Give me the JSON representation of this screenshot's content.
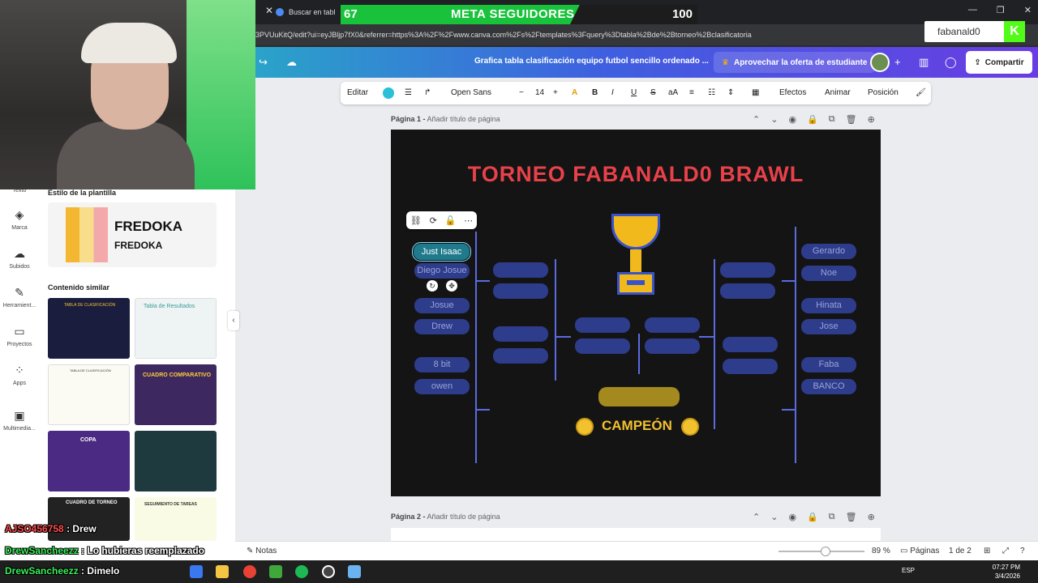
{
  "browser": {
    "tab_title": "Buscar en tabl",
    "url": "3PVUuKitQ/edit?ui=eyJBljp7fX0&referrer=https%3A%2F%2Fwww.canva.com%2Fs%2Ftemplates%3Fquery%3Dtabla%2Bde%2Btorneo%2Bclasificatoria"
  },
  "overlay": {
    "goal_label": "META SEGUIDORES",
    "current": "67",
    "goal": "100",
    "progress": 0.67,
    "kick_user": "fabanald0"
  },
  "canva": {
    "doc_title": "Grafica tabla clasificación equipo futbol sencillo ordenado ...",
    "offer": "Aprovechar la oferta de estudiante",
    "share": "Compartir",
    "toolbar": {
      "edit": "Editar",
      "font": "Open Sans",
      "size": "14",
      "bold": "B",
      "italic": "I",
      "underline": "U",
      "strike": "S",
      "case": "aA",
      "effects": "Efectos",
      "animate": "Animar",
      "position": "Posición",
      "color": "#2bbfd8"
    },
    "page1": {
      "label": "Página 1 -",
      "placeholder": "Añadir título de página"
    },
    "page2": {
      "label": "Página 2 -",
      "placeholder": "Añadir título de página"
    },
    "design": {
      "title": "TORNEO FABANALD0 BRAWL",
      "left_players": [
        "Just Isaac",
        "Diego Josue",
        "Josue",
        "Drew",
        "8 bit",
        "owen"
      ],
      "right_players": [
        "Gerardo",
        "Noe",
        "Hinata",
        "Jose",
        "Faba",
        "BANCO"
      ],
      "champion": "CAMPEÓN"
    },
    "bottom": {
      "notes": "Notas",
      "zoom": "89 %",
      "pages": "Páginas",
      "page_count": "1 de 2"
    }
  },
  "sidebar": {
    "rail": [
      {
        "label": "Texto",
        "icon": "text-icon"
      },
      {
        "label": "Marca",
        "icon": "brand-icon"
      },
      {
        "label": "Subidos",
        "icon": "upload-icon"
      },
      {
        "label": "Herramient...",
        "icon": "tools-icon"
      },
      {
        "label": "Proyectos",
        "icon": "folder-icon"
      },
      {
        "label": "Apps",
        "icon": "apps-icon"
      },
      {
        "label": "Multimedia...",
        "icon": "media-icon"
      }
    ],
    "style_heading": "Estilo de la plantilla",
    "font_preview_1": "FREDOKA",
    "font_preview_2": "FREDOKA",
    "similar_heading": "Contenido similar",
    "thumbs": [
      "TABLA DE CLASIFICACIÓN",
      "Tabla de Resultados",
      "TABLA DE CLASIFICACIÓN",
      "CUADRO COMPARATIVO",
      "COPA",
      "",
      "CUADRO DE TORNEO",
      "SEGUIMIENTO DE TAREAS"
    ]
  },
  "chat": [
    {
      "user": "AJSO456758",
      "msg": "Drew"
    },
    {
      "user": "DrewSancheezz",
      "msg": "Lo hubieras reemplazado"
    },
    {
      "user": "DrewSancheezz",
      "msg": "Dimelo"
    }
  ],
  "taskbar": {
    "lang": "ESP",
    "time": "07:27 PM",
    "date": "3/4/2026"
  }
}
